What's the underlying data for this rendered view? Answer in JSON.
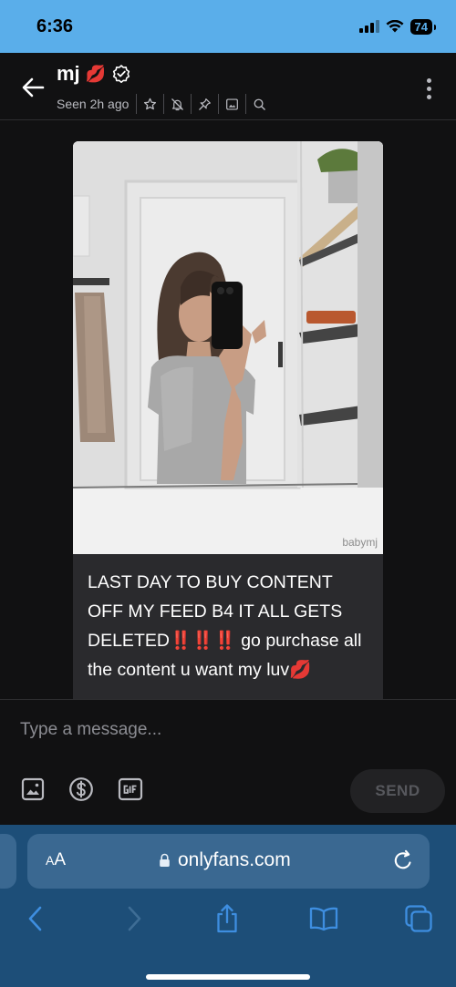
{
  "status_bar": {
    "time": "6:36",
    "battery": "74"
  },
  "header": {
    "name": "mj",
    "seen": "Seen 2h ago",
    "icons": [
      "star-icon",
      "mute-bell-icon",
      "pin-icon",
      "image-icon",
      "search-icon"
    ]
  },
  "message": {
    "watermark": "babymj",
    "text_part1": "LAST DAY TO BUY CONTENT OFF MY FEED B4 IT ALL GETS DELETED",
    "emphasis": "‼️‼️‼️",
    "text_part2": " go purchase all the content u want my luv",
    "emoji_end": "💋"
  },
  "composer": {
    "placeholder": "Type a message...",
    "send_label": "SEND",
    "tools": [
      "image-icon",
      "dollar-icon",
      "gif-icon"
    ]
  },
  "browser": {
    "aa_label": "AA",
    "url": "onlyfans.com"
  },
  "colors": {
    "status_bar": "#5aaeea",
    "app_bg": "#111112",
    "bubble": "#2a2a2d",
    "safari_bar": "#1d4e78",
    "address_bar": "#3a6891",
    "safari_icon": "#3e8ee0"
  }
}
